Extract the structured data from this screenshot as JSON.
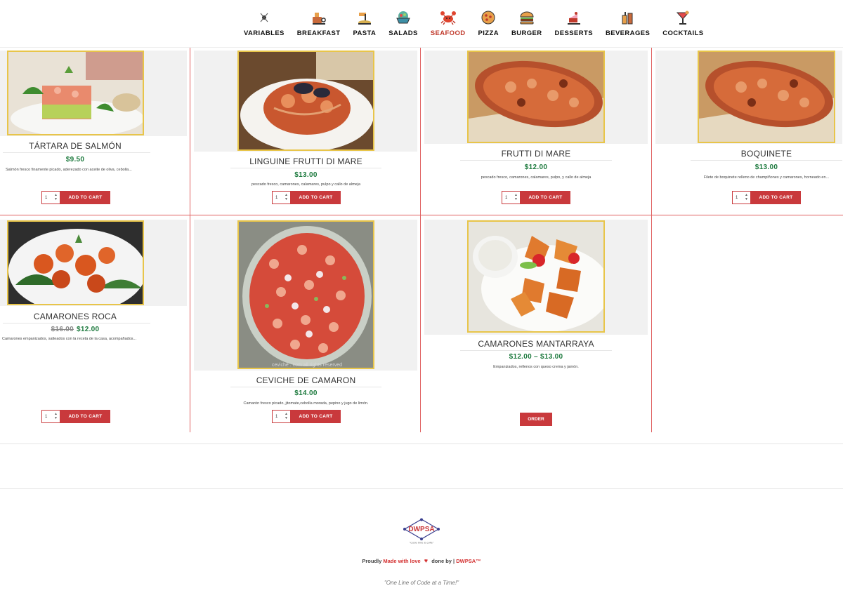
{
  "nav": {
    "items": [
      {
        "label": "VARIABLES",
        "icon": "variables-icon"
      },
      {
        "label": "BREAKFAST",
        "icon": "breakfast-icon"
      },
      {
        "label": "PASTA",
        "icon": "pasta-icon"
      },
      {
        "label": "SALADS",
        "icon": "salad-icon"
      },
      {
        "label": "SEAFOOD",
        "icon": "crab-icon"
      },
      {
        "label": "PIZZA",
        "icon": "pizza-icon"
      },
      {
        "label": "BURGER",
        "icon": "burger-icon"
      },
      {
        "label": "DESSERTS",
        "icon": "cake-icon"
      },
      {
        "label": "BEVERAGES",
        "icon": "beverages-icon"
      },
      {
        "label": "COCKTAILS",
        "icon": "cocktail-icon"
      }
    ],
    "active": "SEAFOOD",
    "active_color": "#c0392b"
  },
  "products": [
    {
      "title": "TÁRTARA DE SALMÓN",
      "price": "$9.50",
      "old_price": "",
      "desc": "Salmón fresco finamente picado, aderezado con aceite de oliva, cebolla...",
      "qty": "1",
      "button": "ADD TO CART"
    },
    {
      "title": "LINGUINE FRUTTI DI MARE",
      "price": "$13.00",
      "old_price": "",
      "desc": "pescado fresco, camarones, calamares, pulpo y callo de almeja",
      "qty": "1",
      "button": "ADD TO CART"
    },
    {
      "title": "FRUTTI DI MARE",
      "price": "$12.00",
      "old_price": "",
      "desc": "pescado fresco, camarones, calamares, pulpo, y callo de almeja",
      "qty": "1",
      "button": "ADD TO CART"
    },
    {
      "title": "BOQUINETE",
      "price": "$13.00",
      "old_price": "",
      "desc": "Filete de boquinete relleno de champiñones y camarones, horneado en...",
      "qty": "1",
      "button": "ADD TO CART"
    },
    {
      "title": "CAMARONES ROCA",
      "price": "$12.00",
      "old_price": "$16.00",
      "desc": "Camarones empanizados, salteados con la receta de la casa, acompañados...",
      "qty": "1",
      "button": "ADD TO CART"
    },
    {
      "title": "CEVICHE DE CAMARON",
      "price": "$14.00",
      "old_price": "",
      "desc": "Camarón fresco picado, jitomate,cebolla morada, pepino y jugo de limón.",
      "qty": "1",
      "button": "ADD TO CART"
    },
    {
      "title": "CAMARONES MANTARRAYA",
      "price": "$12.00 – $13.00",
      "old_price": "",
      "desc": "Empanizados, rellenos con queso crema y jamón.",
      "qty": "",
      "button": "ORDER"
    }
  ],
  "image_watermark": "ceviche . com all rights reserved",
  "footer": {
    "logo_text": "DWPSA",
    "logo_tagline": "\"Code time & coffe\"",
    "made_prefix": "Proudly",
    "made_red": "Made with love",
    "made_mid": "done by |",
    "made_brand": "DWPSA™",
    "motto": "\"One Line of Code at a Time!\""
  },
  "colors": {
    "accent": "#c9393c",
    "price": "#1d7a3e",
    "frame": "#e8c54a",
    "divider": "#e06060"
  }
}
